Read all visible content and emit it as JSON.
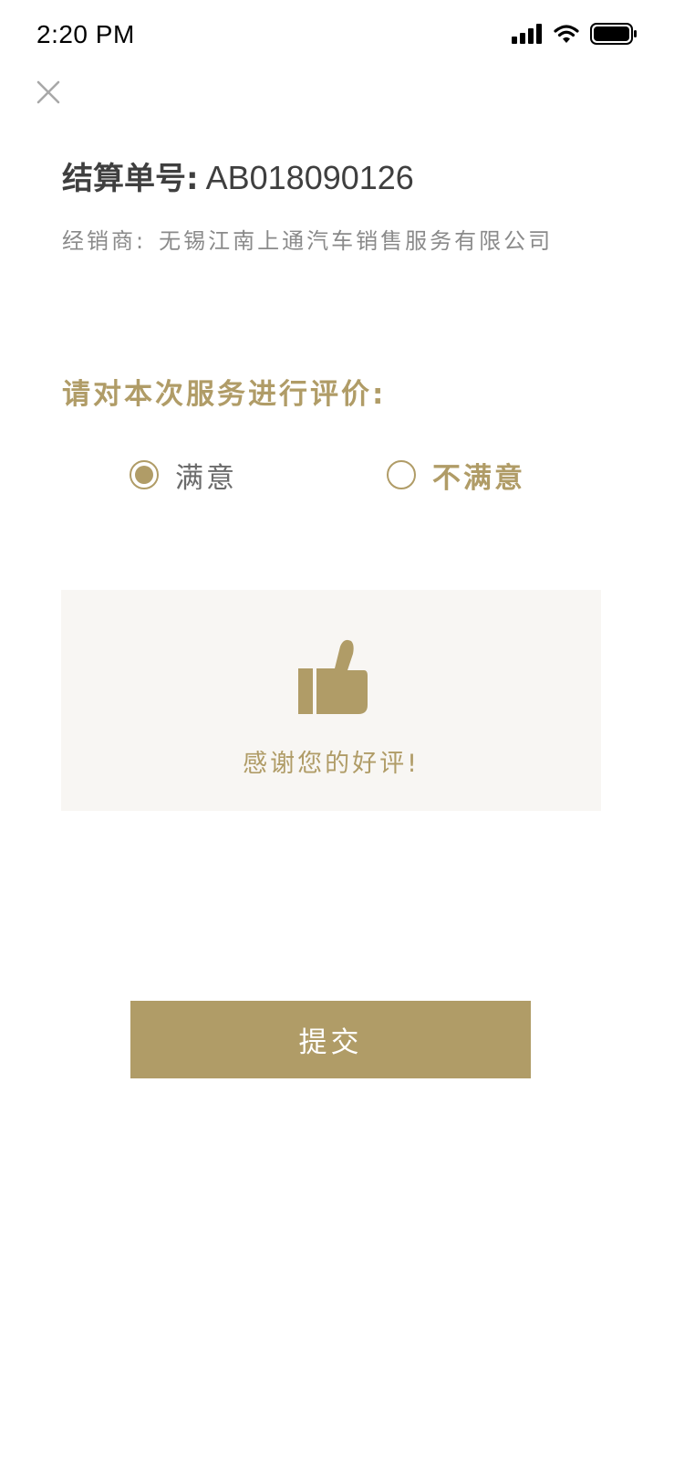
{
  "status_bar": {
    "time": "2:20 PM",
    "icons": [
      "signal-icon",
      "wifi-icon",
      "battery-icon"
    ]
  },
  "header": {
    "close_icon": "close-icon"
  },
  "order": {
    "label": "结算单号:",
    "number": "AB018090126"
  },
  "dealer": {
    "label": "经销商:",
    "name": "无锡江南上通汽车销售服务有限公司"
  },
  "rating": {
    "prompt": "请对本次服务进行评价:",
    "options": [
      {
        "label": "满意",
        "selected": true
      },
      {
        "label": "不满意",
        "selected": false
      }
    ]
  },
  "feedback": {
    "icon": "thumbs-up-icon",
    "message": "感谢您的好评!"
  },
  "submit": {
    "label": "提交"
  },
  "colors": {
    "accent": "#b09c67",
    "panel_bg": "#f8f6f3",
    "title_text": "#3f3f3f",
    "secondary_text": "#8a8a8a"
  }
}
